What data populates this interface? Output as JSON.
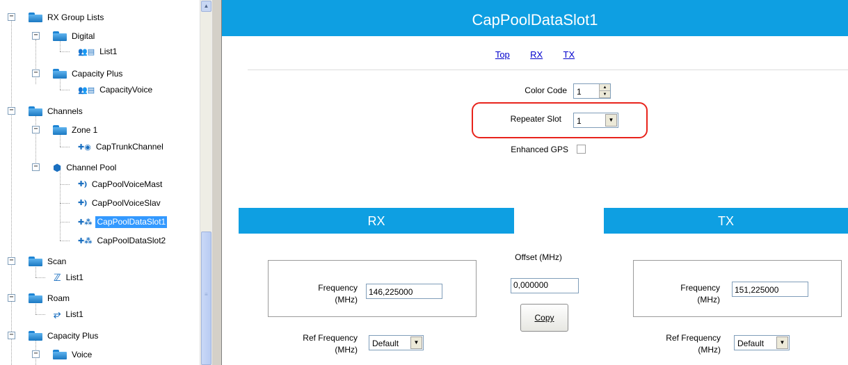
{
  "tree": {
    "items": [
      {
        "label": "RX Group Lists",
        "toggle": "−",
        "icon": "folder-icon"
      },
      {
        "label": "Digital",
        "toggle": "−",
        "icon": "folder-icon"
      },
      {
        "label": "List1",
        "icon": "rx-group-list-icon"
      },
      {
        "label": "Capacity Plus",
        "toggle": "−",
        "icon": "folder-icon"
      },
      {
        "label": "CapacityVoice",
        "icon": "rx-group-list-icon"
      },
      {
        "label": "Channels",
        "toggle": "−",
        "icon": "folder-icon"
      },
      {
        "label": "Zone 1",
        "toggle": "−",
        "icon": "folder-icon"
      },
      {
        "label": "CapTrunkChannel",
        "icon": "channel-icon"
      },
      {
        "label": "Channel Pool",
        "toggle": "−",
        "icon": "channel-pool-icon"
      },
      {
        "label": "CapPoolVoiceMast",
        "icon": "voice-channel-icon"
      },
      {
        "label": "CapPoolVoiceSlav",
        "icon": "voice-channel-icon"
      },
      {
        "label": "CapPoolDataSlot1",
        "icon": "data-channel-icon",
        "selected": true
      },
      {
        "label": "CapPoolDataSlot2",
        "icon": "data-channel-icon"
      },
      {
        "label": "Scan",
        "toggle": "−",
        "icon": "folder-icon"
      },
      {
        "label": "List1",
        "icon": "scan-list-icon"
      },
      {
        "label": "Roam",
        "toggle": "−",
        "icon": "folder-icon"
      },
      {
        "label": "List1",
        "icon": "roam-list-icon"
      },
      {
        "label": "Capacity Plus",
        "toggle": "−",
        "icon": "folder-icon"
      },
      {
        "label": "Voice",
        "toggle": "−",
        "icon": "folder-icon"
      }
    ]
  },
  "header": {
    "title": "CapPoolDataSlot1"
  },
  "nav": {
    "top": "Top",
    "rx": "RX",
    "tx": "TX"
  },
  "settings": {
    "color_code_label": "Color Code",
    "color_code_value": "1",
    "repeater_slot_label": "Repeater Slot",
    "repeater_slot_value": "1",
    "enhanced_gps_label": "Enhanced GPS",
    "enhanced_gps_checked": false
  },
  "rx": {
    "section_title": "RX",
    "frequency_label_1": "Frequency",
    "frequency_label_2": "(MHz)",
    "frequency_value": "146,225000",
    "ref_frequency_label_1": "Ref Frequency",
    "ref_frequency_label_2": "(MHz)",
    "ref_frequency_value": "Default"
  },
  "offset": {
    "label": "Offset (MHz)",
    "value": "0,000000",
    "copy_label": "Copy"
  },
  "tx": {
    "section_title": "TX",
    "frequency_label_1": "Frequency",
    "frequency_label_2": "(MHz)",
    "frequency_value": "151,225000",
    "ref_frequency_label_1": "Ref Frequency",
    "ref_frequency_label_2": "(MHz)",
    "ref_frequency_value": "Default"
  },
  "colors": {
    "accent": "#0e9fe2",
    "highlight_border": "#e8231b",
    "selection": "#3399ff"
  }
}
